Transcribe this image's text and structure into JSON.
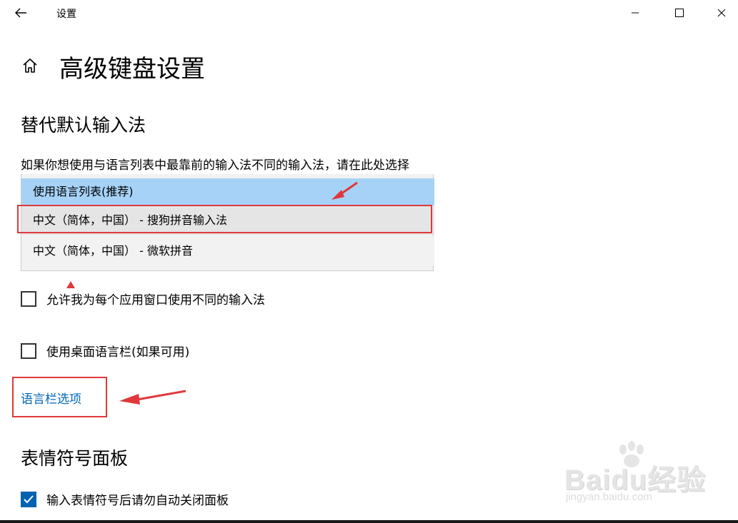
{
  "window": {
    "title": "设置",
    "back_icon": "back-arrow-icon",
    "minimize_icon": "minimize-icon",
    "maximize_icon": "maximize-icon",
    "close_icon": "close-icon"
  },
  "page": {
    "home_icon": "home-icon",
    "title": "高级键盘设置"
  },
  "override_section": {
    "title": "替代默认输入法",
    "description": "如果你想使用与语言列表中最靠前的输入法不同的输入法，请在此处选择",
    "options": [
      {
        "label": "使用语言列表(推荐)",
        "state": "selected"
      },
      {
        "label": "中文（简体，中国） - 搜狗拼音输入法",
        "state": "hover"
      },
      {
        "label": "中文（简体，中国） - 微软拼音",
        "state": "normal"
      }
    ]
  },
  "checkboxes": [
    {
      "label": "允许我为每个应用窗口使用不同的输入法",
      "checked": false
    },
    {
      "label": "使用桌面语言栏(如果可用)",
      "checked": false
    }
  ],
  "language_bar_link": "语言栏选项",
  "emoji_section": {
    "title": "表情符号面板",
    "checkbox": {
      "label": "输入表情符号后请勿自动关闭面板",
      "checked": true
    }
  },
  "watermark": {
    "brand": "Baidu经验",
    "url": "jingyan.baidu.com"
  },
  "colors": {
    "selected_option": "#a6d2f7",
    "hover_option": "#e5e5e5",
    "link": "#0067b8",
    "checkbox_checked": "#0063b1",
    "annotation_red": "#e0383b"
  }
}
